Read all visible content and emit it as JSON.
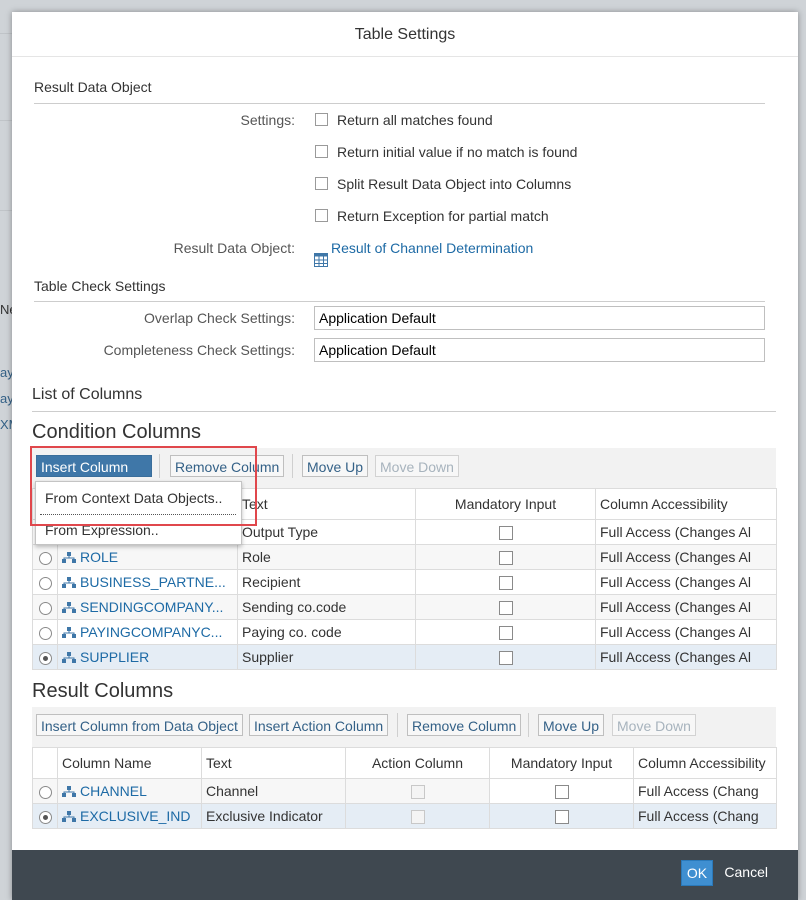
{
  "dialog": {
    "title": "Table Settings"
  },
  "background": {
    "fragments": [
      "Ne",
      "ay",
      "ay",
      "XM"
    ]
  },
  "result_data_object": {
    "heading": "Result Data Object",
    "settings_label": "Settings:",
    "options": [
      "Return all matches found",
      "Return initial value if no match is found",
      "Split Result Data Object into Columns",
      "Return Exception for partial match"
    ],
    "rdo_label": "Result Data Object:",
    "rdo_value": "Result of Channel Determination"
  },
  "table_check": {
    "heading": "Table Check Settings",
    "overlap_label": "Overlap Check Settings:",
    "overlap_value": "Application Default",
    "completeness_label": "Completeness Check Settings:",
    "completeness_value": "Application Default"
  },
  "list_of_columns": {
    "heading": "List of Columns"
  },
  "condition_columns": {
    "heading": "Condition Columns",
    "toolbar": {
      "insert": "Insert Column",
      "remove": "Remove Column",
      "move_up": "Move Up",
      "move_down": "Move Down"
    },
    "insert_menu": [
      "From Context Data Objects..",
      "From Expression.."
    ],
    "headers": [
      "Text",
      "Mandatory Input",
      "Column Accessibility"
    ],
    "rows": [
      {
        "name": "",
        "text": "Output Type",
        "access": "Full Access (Changes Al"
      },
      {
        "name": "ROLE",
        "text": "Role",
        "access": "Full Access (Changes Al"
      },
      {
        "name": "BUSINESS_PARTNE...",
        "text": "Recipient",
        "access": "Full Access (Changes Al"
      },
      {
        "name": "SENDINGCOMPANY...",
        "text": "Sending co.code",
        "access": "Full Access (Changes Al"
      },
      {
        "name": "PAYINGCOMPANYC...",
        "text": "Paying co. code",
        "access": "Full Access (Changes Al"
      },
      {
        "name": "SUPPLIER",
        "text": "Supplier",
        "access": "Full Access (Changes Al"
      }
    ]
  },
  "result_columns": {
    "heading": "Result Columns",
    "toolbar": {
      "insert_from_do": "Insert Column from Data Object",
      "insert_action": "Insert Action Column",
      "remove": "Remove Column",
      "move_up": "Move Up",
      "move_down": "Move Down"
    },
    "headers": [
      "Column Name",
      "Text",
      "Action Column",
      "Mandatory Input",
      "Column Accessibility"
    ],
    "rows": [
      {
        "name": "CHANNEL",
        "text": "Channel",
        "access": "Full Access (Chang"
      },
      {
        "name": "EXCLUSIVE_IND",
        "text": "Exclusive Indicator",
        "access": "Full Access (Chang"
      }
    ]
  },
  "footer": {
    "ok": "OK",
    "cancel": "Cancel"
  },
  "colors": {
    "accent": "#3f77a8",
    "highlight": "#e0474c",
    "footer": "#3f4850",
    "link": "#1d6aa5"
  }
}
